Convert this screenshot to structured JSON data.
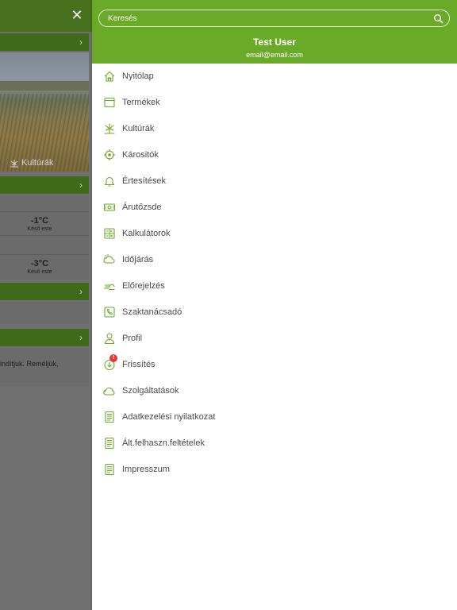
{
  "background": {
    "photo_label": "Kultúrák",
    "temps": [
      {
        "value": "-1°C",
        "label": "Késő este"
      },
      {
        "value": "-3°C",
        "label": "Késő este"
      }
    ],
    "message": "indítjuk. Reméljük,"
  },
  "drawer": {
    "search_placeholder": "Keresés",
    "user_name": "Test User",
    "user_email": "email@email.com",
    "accent_color": "#6aaa28",
    "menu": [
      {
        "label": "Nyitólap",
        "icon": "home-icon"
      },
      {
        "label": "Termékek",
        "icon": "window-icon"
      },
      {
        "label": "Kultúrák",
        "icon": "plant-icon"
      },
      {
        "label": "Kárositók",
        "icon": "crosshair-icon"
      },
      {
        "label": "Értesítések",
        "icon": "bell-icon"
      },
      {
        "label": "Árutőzsde",
        "icon": "money-icon"
      },
      {
        "label": "Kalkulátorok",
        "icon": "calculator-icon"
      },
      {
        "label": "Időjárás",
        "icon": "weather-icon"
      },
      {
        "label": "Előrejelzés",
        "icon": "forecast-icon"
      },
      {
        "label": "Szaktanácsadó",
        "icon": "phone-icon"
      },
      {
        "label": "Profil",
        "icon": "person-icon"
      },
      {
        "label": "Frissítés",
        "icon": "update-icon",
        "badge": "!"
      },
      {
        "label": "Szolgáltatások",
        "icon": "cloud-icon"
      },
      {
        "label": "Adatkezelési nyilatkozat",
        "icon": "document-icon"
      },
      {
        "label": "Ált.felhaszn.feltételek",
        "icon": "document-icon"
      },
      {
        "label": "Impresszum",
        "icon": "document-icon"
      }
    ]
  }
}
